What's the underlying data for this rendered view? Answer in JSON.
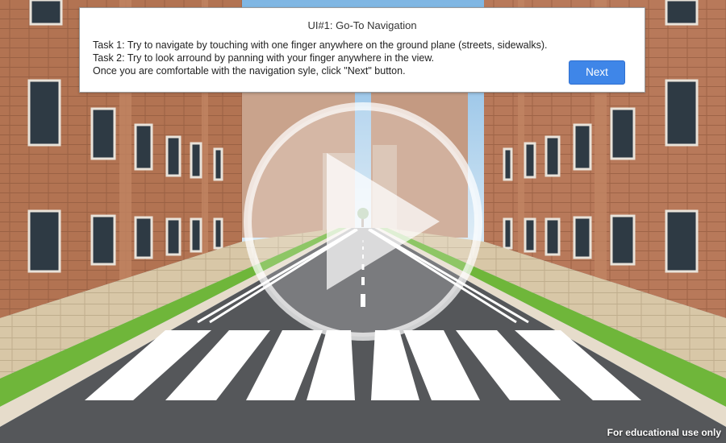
{
  "dialog": {
    "title": "UI#1: Go-To Navigation",
    "lines": [
      "Task 1: Try to navigate by touching with one finger anywhere on the ground plane (streets, sidewalks).",
      "Task 2: Try to look arround by panning with your finger anywhere in the view.",
      "Once you are comfortable with the navigation syle, click \"Next\" button."
    ],
    "next_label": "Next"
  },
  "watermark": "For educational use only",
  "colors": {
    "accent": "#3f86e8",
    "brick": "#b27352",
    "road": "#55575a",
    "grass": "#6fb63a",
    "sky": "#9ec7e6"
  },
  "icons": {
    "play": "play-icon"
  }
}
